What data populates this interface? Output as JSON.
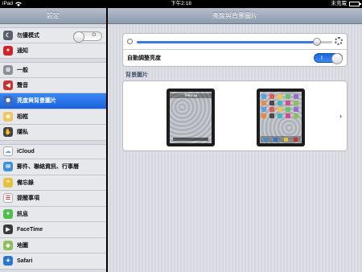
{
  "status_bar": {
    "carrier": "iPad",
    "time": "下午2:18",
    "charge": "未充電"
  },
  "master": {
    "title": "設定",
    "items": [
      {
        "label": "勿擾模式",
        "icon": "moon-icon",
        "toggle": "O"
      },
      {
        "label": "通知",
        "icon": "notifications-icon"
      },
      {
        "label": "一般",
        "icon": "gear-icon"
      },
      {
        "label": "聲音",
        "icon": "speaker-icon"
      },
      {
        "label": "亮度與背景圖片",
        "icon": "brightness-icon",
        "selected": true
      },
      {
        "label": "相框",
        "icon": "picture-frame-icon"
      },
      {
        "label": "隱私",
        "icon": "hand-icon"
      },
      {
        "label": "iCloud",
        "icon": "cloud-icon"
      },
      {
        "label": "郵件、聯絡資訊、行事曆",
        "icon": "mail-icon"
      },
      {
        "label": "備忘錄",
        "icon": "notes-icon"
      },
      {
        "label": "提醒事項",
        "icon": "reminders-icon"
      },
      {
        "label": "訊息",
        "icon": "messages-icon"
      },
      {
        "label": "FaceTime",
        "icon": "facetime-icon"
      },
      {
        "label": "地圖",
        "icon": "maps-icon"
      },
      {
        "label": "Safari",
        "icon": "compass-icon"
      }
    ]
  },
  "detail": {
    "title": "亮度與背景圖片",
    "brightness_level": 0.92,
    "auto_brightness_label": "自動調整亮度",
    "auto_brightness_toggle": "I",
    "wallpaper_header": "背景圖片",
    "lock_screen_time": "下午2:18"
  },
  "colors": {
    "selected_row": "#1a62de",
    "toggle_on": "#2a74e4"
  }
}
